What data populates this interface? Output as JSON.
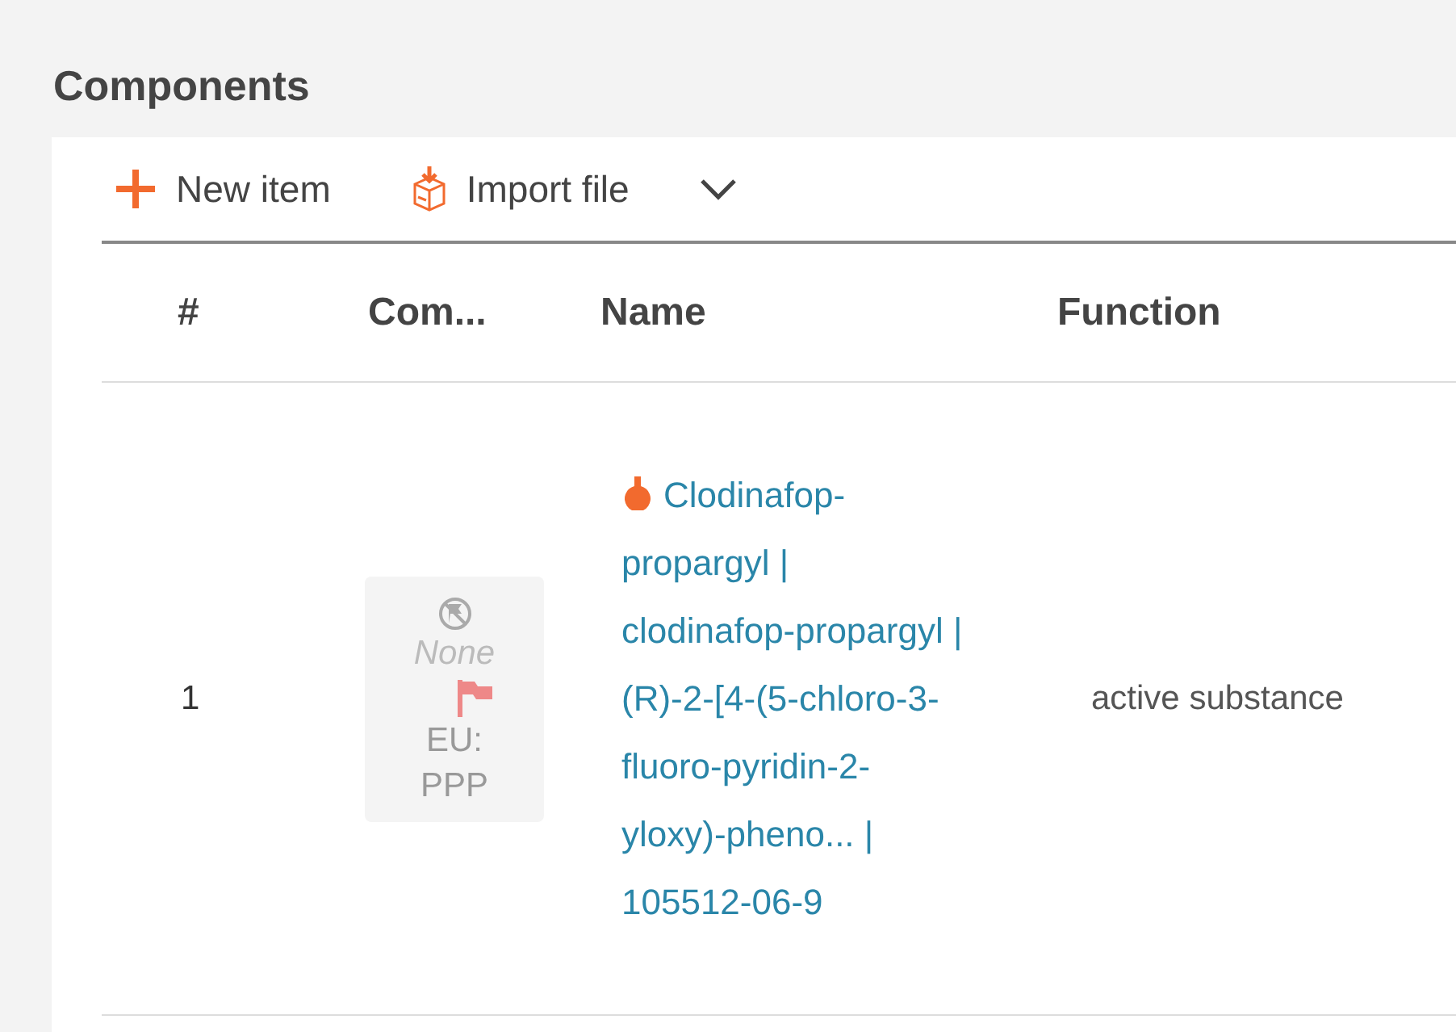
{
  "section": {
    "title": "Components"
  },
  "toolbar": [
    {
      "kind": "new",
      "label": "New item"
    },
    {
      "kind": "import",
      "label": "Import file"
    },
    {
      "kind": "menu"
    }
  ],
  "table": {
    "columns": [
      "#",
      "Com...",
      "Name",
      "Function"
    ],
    "rows": [
      {
        "number": "1",
        "component": {
          "status": "None",
          "region": "EU: PPP"
        },
        "name": "Clodinafop-propargyl | clodinafop-propargyl | (R)-2-[4-(5-chloro-3-fluoro-pyridin-2-yloxy)-pheno... | 105512-06-9",
        "function": "active substance"
      }
    ]
  }
}
